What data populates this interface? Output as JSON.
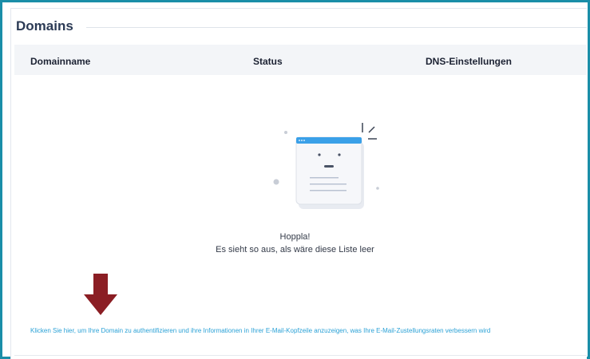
{
  "section": {
    "title": "Domains"
  },
  "table": {
    "columns": [
      "Domainname",
      "Status",
      "DNS-Einstellungen"
    ]
  },
  "empty_state": {
    "title": "Hoppla!",
    "message": "Es sieht so aus, als wäre diese Liste leer"
  },
  "help_link": {
    "text": "Klicken Sie hier, um Ihre Domain zu authentifizieren und ihre Informationen in Ihrer E-Mail-Kopfzeile anzuzeigen, was Ihre E-Mail-Zustellungsraten verbessern wird"
  },
  "colors": {
    "frame_border": "#1a8ea8",
    "arrow": "#8b1e24",
    "link": "#2aa1d6",
    "header_bg": "#f3f5f8",
    "illustration_accent": "#3aa0e8"
  },
  "icons": {
    "empty_state": "empty-browser-window-illustration",
    "annotation": "down-arrow-icon"
  }
}
